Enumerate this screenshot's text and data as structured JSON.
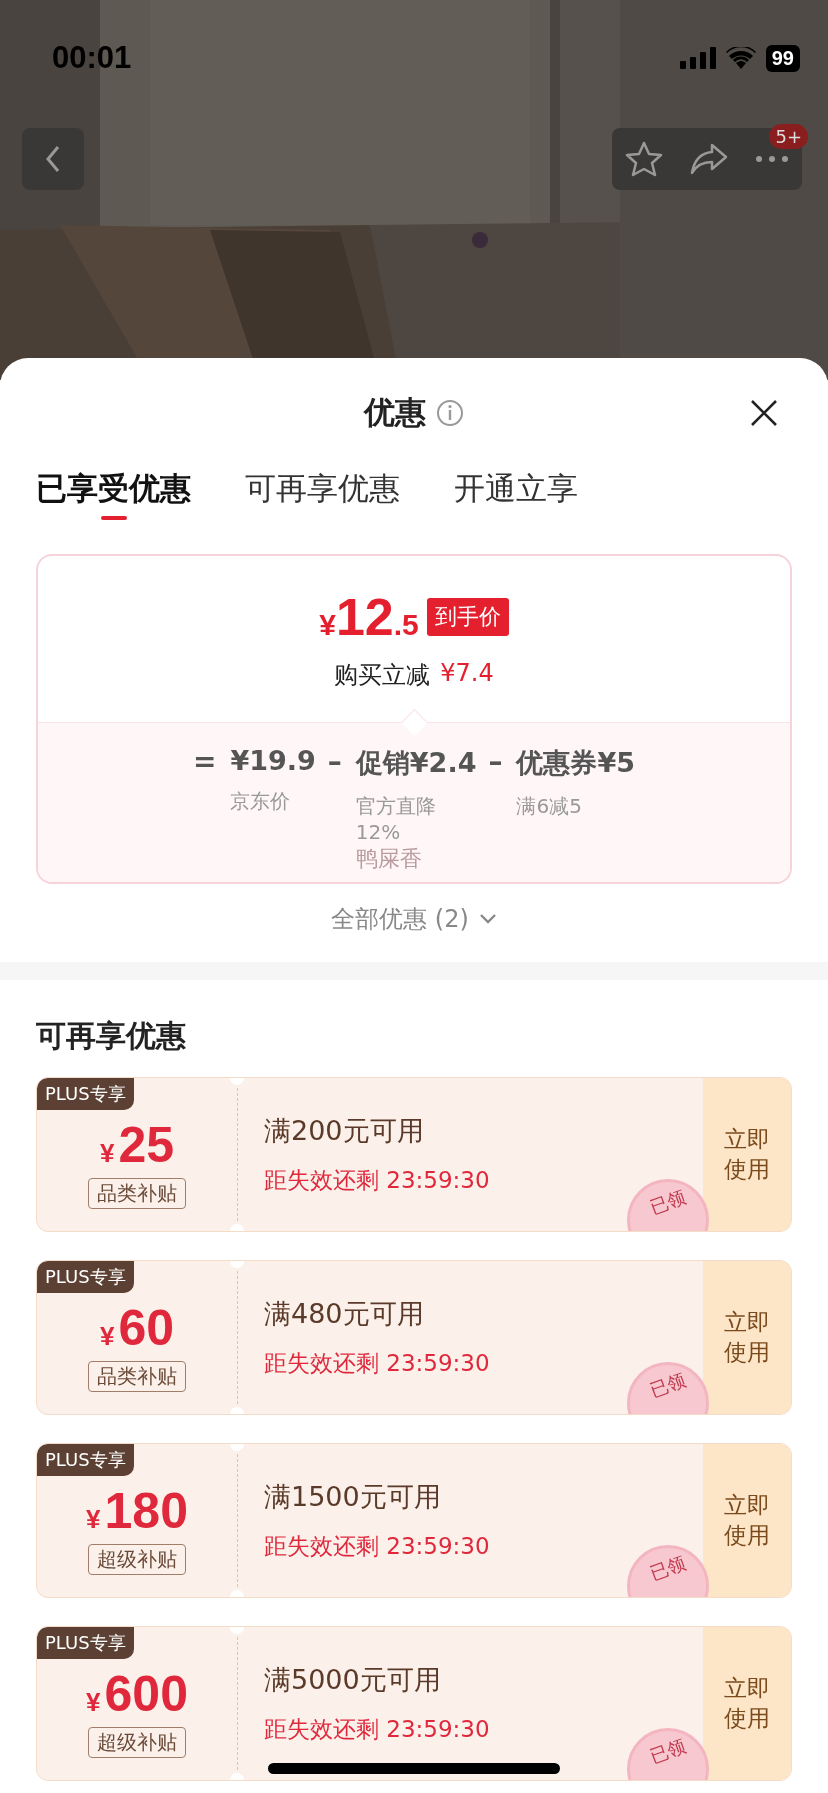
{
  "status_bar": {
    "time": "00:01",
    "battery": "99"
  },
  "nav": {
    "badge": "5+"
  },
  "sheet": {
    "title": "优惠",
    "tabs": [
      {
        "label": "已享受优惠",
        "selected": true
      },
      {
        "label": "可再享优惠",
        "selected": false
      },
      {
        "label": "开通立享",
        "selected": false
      }
    ],
    "price_card": {
      "currency": "¥",
      "integer": "12",
      "decimal": ".5",
      "price_tag": "到手价",
      "saving_label": "购买立减",
      "saving": "¥7.4",
      "breakdown": [
        {
          "operator": "=",
          "amount": "¥19.9",
          "label": "京东价"
        },
        {
          "operator": "–",
          "amount": "促销¥2.4",
          "label": "官方直降12%",
          "note": "鸭屎香"
        },
        {
          "operator": "–",
          "amount": "优惠券¥5",
          "label": "满6减5"
        }
      ]
    },
    "all_offers": "全部优惠 (2)",
    "section_title": "可再享优惠",
    "coupons": [
      {
        "badge": "PLUS专享",
        "currency": "¥",
        "amount": "25",
        "tag": "品类补贴",
        "condition": "满200元可用",
        "countdown": "距失效还剩 23:59:30",
        "action": "立即使用",
        "stamp": "已领"
      },
      {
        "badge": "PLUS专享",
        "currency": "¥",
        "amount": "60",
        "tag": "品类补贴",
        "condition": "满480元可用",
        "countdown": "距失效还剩 23:59:30",
        "action": "立即使用",
        "stamp": "已领"
      },
      {
        "badge": "PLUS专享",
        "currency": "¥",
        "amount": "180",
        "tag": "超级补贴",
        "condition": "满1500元可用",
        "countdown": "距失效还剩 23:59:30",
        "action": "立即使用",
        "stamp": "已领"
      },
      {
        "badge": "PLUS专享",
        "currency": "¥",
        "amount": "600",
        "tag": "超级补贴",
        "condition": "满5000元可用",
        "countdown": "距失效还剩 23:59:30",
        "action": "立即使用",
        "stamp": "已领"
      }
    ]
  }
}
